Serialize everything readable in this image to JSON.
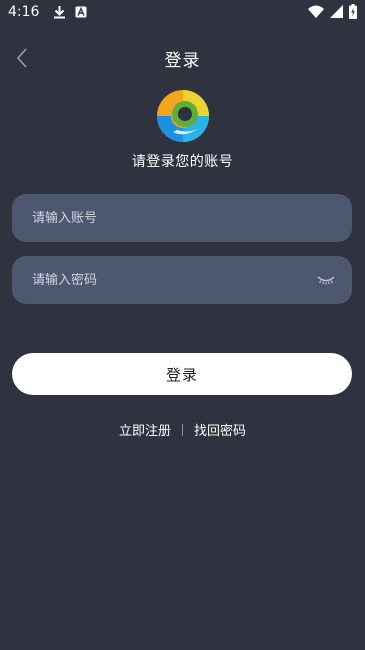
{
  "status_bar": {
    "time": "4:16",
    "left_icons": [
      "download-icon",
      "app-notification-icon"
    ],
    "right_icons": [
      "wifi-icon",
      "cell-signal-icon",
      "battery-charging-icon"
    ]
  },
  "header": {
    "title": "登录",
    "back_icon": "chevron-left-icon"
  },
  "logo": {
    "icon": "app-logo-icon"
  },
  "subtitle": "请登录您的账号",
  "form": {
    "account_placeholder": "请输入账号",
    "password_placeholder": "请输入密码",
    "password_toggle_icon": "eye-closed-icon",
    "login_label": "登录"
  },
  "links": {
    "register": "立即注册",
    "forgot_password": "找回密码"
  },
  "colors": {
    "background": "#2e333f",
    "field_background": "#4d576f",
    "button_background": "#ffffff",
    "button_text": "#1f232c"
  }
}
